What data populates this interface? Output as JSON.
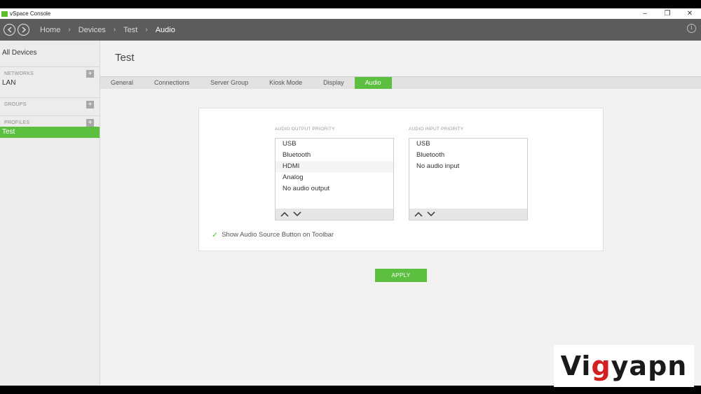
{
  "window": {
    "title": "vSpace Console",
    "controls": [
      "–",
      "❐",
      "✕"
    ]
  },
  "nav": {
    "back_icon": "chevron-left",
    "forward_icon": "chevron-right",
    "breadcrumbs": [
      "Home",
      "Devices",
      "Test",
      "Audio"
    ],
    "separator": "›"
  },
  "sidebar": {
    "all_devices": "All Devices",
    "networks_label": "NETWORKS",
    "networks_item": "LAN",
    "groups_label": "GROUPS",
    "profiles_label": "PROFILES",
    "profiles_item": "Test",
    "add_symbol": "+"
  },
  "main": {
    "title": "Test",
    "tabs": [
      "General",
      "Connections",
      "Server Group",
      "Kiosk Mode",
      "Display",
      "Audio"
    ],
    "active_tab": "Audio"
  },
  "audio": {
    "output_label": "AUDIO OUTPUT PRIORITY",
    "output_items": [
      "USB",
      "Bluetooth",
      "HDMI",
      "Analog",
      "No audio output"
    ],
    "input_label": "AUDIO INPUT PRIORITY",
    "input_items": [
      "USB",
      "Bluetooth",
      "No audio input"
    ],
    "show_toolbar_label": "Show Audio Source Button on Toolbar",
    "show_toolbar_checked": true,
    "apply_label": "APPLY"
  },
  "watermark": {
    "text_a": "Vi",
    "text_b": "g",
    "text_c": "yapn"
  },
  "colors": {
    "accent": "#5cbf3f",
    "navbar": "#5c5c5c"
  }
}
